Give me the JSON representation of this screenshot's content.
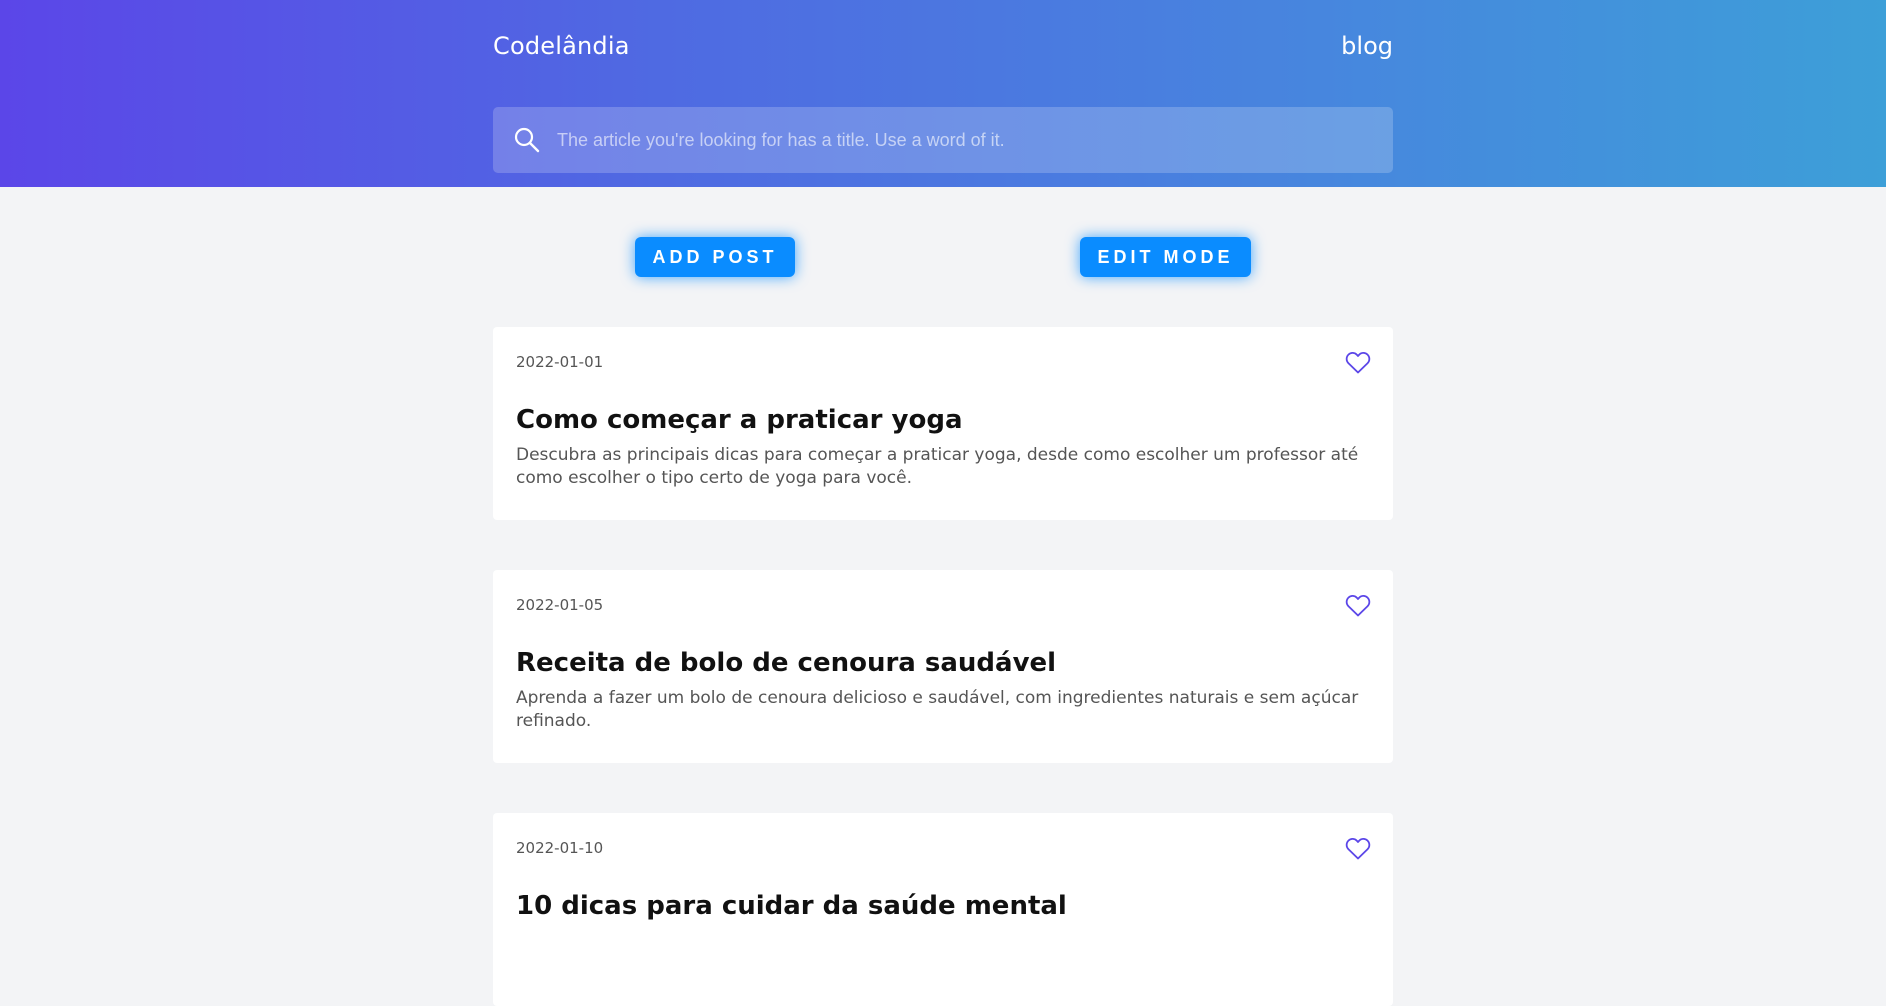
{
  "header": {
    "brand": "Codelândia",
    "nav_link": "blog",
    "search_placeholder": "The article you're looking for has a title. Use a word of it."
  },
  "actions": {
    "add_post_label": "ADD POST",
    "edit_mode_label": "EDIT MODE"
  },
  "posts": [
    {
      "date": "2022-01-01",
      "title": "Como começar a praticar yoga",
      "description": "Descubra as principais dicas para começar a praticar yoga, desde como escolher um professor até como escolher o tipo certo de yoga para você."
    },
    {
      "date": "2022-01-05",
      "title": "Receita de bolo de cenoura saudável",
      "description": "Aprenda a fazer um bolo de cenoura delicioso e saudável, com ingredientes naturais e sem açúcar refinado."
    },
    {
      "date": "2022-01-10",
      "title": "10 dicas para cuidar da saúde mental",
      "description": ""
    }
  ],
  "colors": {
    "gradient_start": "#5b46e8",
    "gradient_end": "#3d9fd8",
    "button": "#0a8cff",
    "heart": "#5b46e8",
    "background": "#f3f4f6"
  },
  "icons": {
    "search": "search-icon",
    "like": "heart-outline-icon"
  }
}
